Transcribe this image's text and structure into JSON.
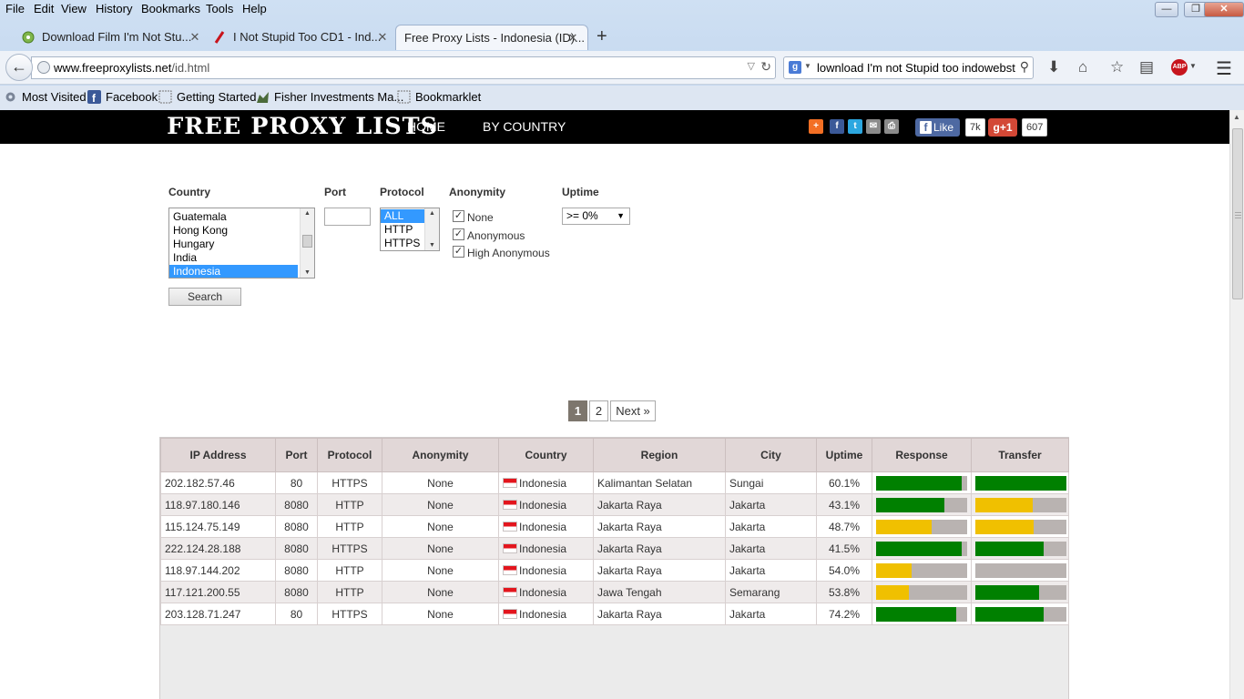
{
  "browser": {
    "menu": [
      "File",
      "Edit",
      "View",
      "History",
      "Bookmarks",
      "Tools",
      "Help"
    ],
    "window_buttons": [
      "minimize",
      "restore",
      "close"
    ],
    "tabs": [
      {
        "title": "Download Film I'm Not Stu...",
        "icon": "film-favicon",
        "active": false
      },
      {
        "title": "I Not Stupid Too CD1 - Ind...",
        "icon": "red-slash-favicon",
        "active": false
      },
      {
        "title": "Free Proxy Lists - Indonesia (ID)...",
        "icon": "",
        "active": true
      }
    ],
    "new_tab": "+",
    "url_host": "www.freeproxylists.net",
    "url_path": "/id.html",
    "search_engine": "g",
    "search_text": "lownload I'm not Stupid too indowebster",
    "bookmarks": [
      {
        "label": "Most Visited",
        "icon": "gear-icon"
      },
      {
        "label": "Facebook",
        "icon": "facebook-icon"
      },
      {
        "label": "Getting Started",
        "icon": "page-icon"
      },
      {
        "label": "Fisher Investments Ma...",
        "icon": "bull-icon"
      },
      {
        "label": "Bookmarklet",
        "icon": "page-icon"
      }
    ]
  },
  "site": {
    "logo": "FREE PROXY LISTS",
    "nav": [
      "HOME",
      "BY COUNTRY"
    ],
    "fb_like": "Like",
    "fb_count": "7k",
    "gplus": "g+1",
    "gplus_count": "607"
  },
  "filters": {
    "country_label": "Country",
    "port_label": "Port",
    "protocol_label": "Protocol",
    "anonymity_label": "Anonymity",
    "uptime_label": "Uptime",
    "countries": [
      {
        "name": "Guatemala",
        "selected": false
      },
      {
        "name": "Hong Kong",
        "selected": false
      },
      {
        "name": "Hungary",
        "selected": false
      },
      {
        "name": "India",
        "selected": false
      },
      {
        "name": "Indonesia",
        "selected": true
      }
    ],
    "port_value": "",
    "protocols": [
      {
        "name": "ALL",
        "selected": true
      },
      {
        "name": "HTTP",
        "selected": false
      },
      {
        "name": "HTTPS",
        "selected": false
      }
    ],
    "anonymity": [
      {
        "label": "None",
        "checked": true
      },
      {
        "label": "Anonymous",
        "checked": true
      },
      {
        "label": "High Anonymous",
        "checked": true
      }
    ],
    "uptime_value": ">= 0%",
    "search_button": "Search"
  },
  "pagination": {
    "pages": [
      "1",
      "2"
    ],
    "current": "1",
    "next": "Next »"
  },
  "table": {
    "headers": [
      "IP Address",
      "Port",
      "Protocol",
      "Anonymity",
      "Country",
      "Region",
      "City",
      "Uptime",
      "Response",
      "Transfer"
    ],
    "rows": [
      {
        "ip": "202.182.57.46",
        "port": "80",
        "protocol": "HTTPS",
        "anonymity": "None",
        "country": "Indonesia",
        "region": "Kalimantan Selatan",
        "city": "Sungai",
        "uptime": "60.1%",
        "response": 0.94,
        "response_color": "#008000",
        "transfer": 1.0,
        "transfer_color": "#008000"
      },
      {
        "ip": "118.97.180.146",
        "port": "8080",
        "protocol": "HTTP",
        "anonymity": "None",
        "country": "Indonesia",
        "region": "Jakarta Raya",
        "city": "Jakarta",
        "uptime": "43.1%",
        "response": 0.75,
        "response_color": "#008000",
        "transfer": 0.63,
        "transfer_color": "#f0c000"
      },
      {
        "ip": "115.124.75.149",
        "port": "8080",
        "protocol": "HTTP",
        "anonymity": "None",
        "country": "Indonesia",
        "region": "Jakarta Raya",
        "city": "Jakarta",
        "uptime": "48.7%",
        "response": 0.61,
        "response_color": "#f0c000",
        "transfer": 0.64,
        "transfer_color": "#f0c000"
      },
      {
        "ip": "222.124.28.188",
        "port": "8080",
        "protocol": "HTTPS",
        "anonymity": "None",
        "country": "Indonesia",
        "region": "Jakarta Raya",
        "city": "Jakarta",
        "uptime": "41.5%",
        "response": 0.94,
        "response_color": "#008000",
        "transfer": 0.75,
        "transfer_color": "#008000"
      },
      {
        "ip": "118.97.144.202",
        "port": "8080",
        "protocol": "HTTP",
        "anonymity": "None",
        "country": "Indonesia",
        "region": "Jakarta Raya",
        "city": "Jakarta",
        "uptime": "54.0%",
        "response": 0.39,
        "response_color": "#f0c000",
        "transfer": 0.0,
        "transfer_color": "#f0c000"
      },
      {
        "ip": "117.121.200.55",
        "port": "8080",
        "protocol": "HTTP",
        "anonymity": "None",
        "country": "Indonesia",
        "region": "Jawa Tengah",
        "city": "Semarang",
        "uptime": "53.8%",
        "response": 0.36,
        "response_color": "#f0c000",
        "transfer": 0.7,
        "transfer_color": "#008000"
      },
      {
        "ip": "203.128.71.247",
        "port": "80",
        "protocol": "HTTPS",
        "anonymity": "None",
        "country": "Indonesia",
        "region": "Jakarta Raya",
        "city": "Jakarta",
        "uptime": "74.2%",
        "response": 0.88,
        "response_color": "#008000",
        "transfer": 0.75,
        "transfer_color": "#008000"
      }
    ]
  }
}
